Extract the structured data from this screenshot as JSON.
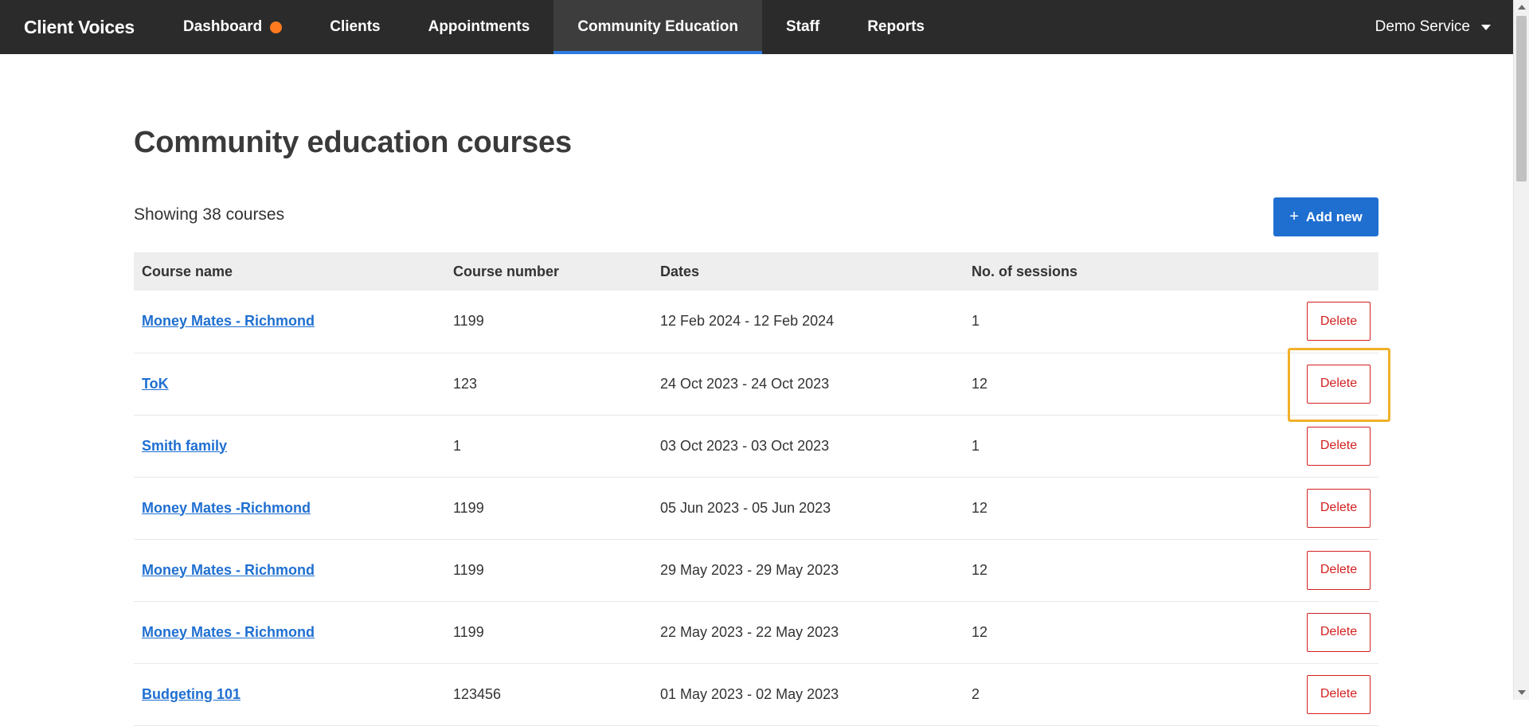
{
  "nav": {
    "brand": "Client Voices",
    "items": [
      {
        "label": "Dashboard"
      },
      {
        "label": "Clients"
      },
      {
        "label": "Appointments"
      },
      {
        "label": "Community Education"
      },
      {
        "label": "Staff"
      },
      {
        "label": "Reports"
      }
    ],
    "active_item": "Community Education",
    "service": "Demo Service",
    "notification_dot_color": "#ff7a1f",
    "active_underline_color": "#2d7be5"
  },
  "page": {
    "title": "Community education courses",
    "showing": "Showing 38 courses",
    "add_new_label": "Add new",
    "add_new_icon": "plus-icon"
  },
  "table": {
    "headers": [
      "Course name",
      "Course number",
      "Dates",
      "No. of sessions"
    ],
    "delete_label": "Delete",
    "rows": [
      {
        "name": "Money Mates - Richmond",
        "number": "1199",
        "dates": "12 Feb 2024 - 12 Feb 2024",
        "sessions": "1"
      },
      {
        "name": "ToK",
        "number": "123",
        "dates": "24 Oct 2023 - 24 Oct 2023",
        "sessions": "12"
      },
      {
        "name": "Smith family",
        "number": "1",
        "dates": "03 Oct 2023 - 03 Oct 2023",
        "sessions": "1"
      },
      {
        "name": "Money Mates -Richmond",
        "number": "1199",
        "dates": "05 Jun 2023 - 05 Jun 2023",
        "sessions": "12"
      },
      {
        "name": "Money Mates - Richmond",
        "number": "1199",
        "dates": "29 May 2023 - 29 May 2023",
        "sessions": "12"
      },
      {
        "name": "Money Mates - Richmond",
        "number": "1199",
        "dates": "22 May 2023 - 22 May 2023",
        "sessions": "12"
      },
      {
        "name": "Budgeting 101",
        "number": "123456",
        "dates": "01 May 2023 - 02 May 2023",
        "sessions": "2"
      }
    ]
  },
  "colors": {
    "nav_bg": "#2b2b2b",
    "primary": "#1f6fd1",
    "danger": "#d32020",
    "highlight": "#f0b02a"
  }
}
